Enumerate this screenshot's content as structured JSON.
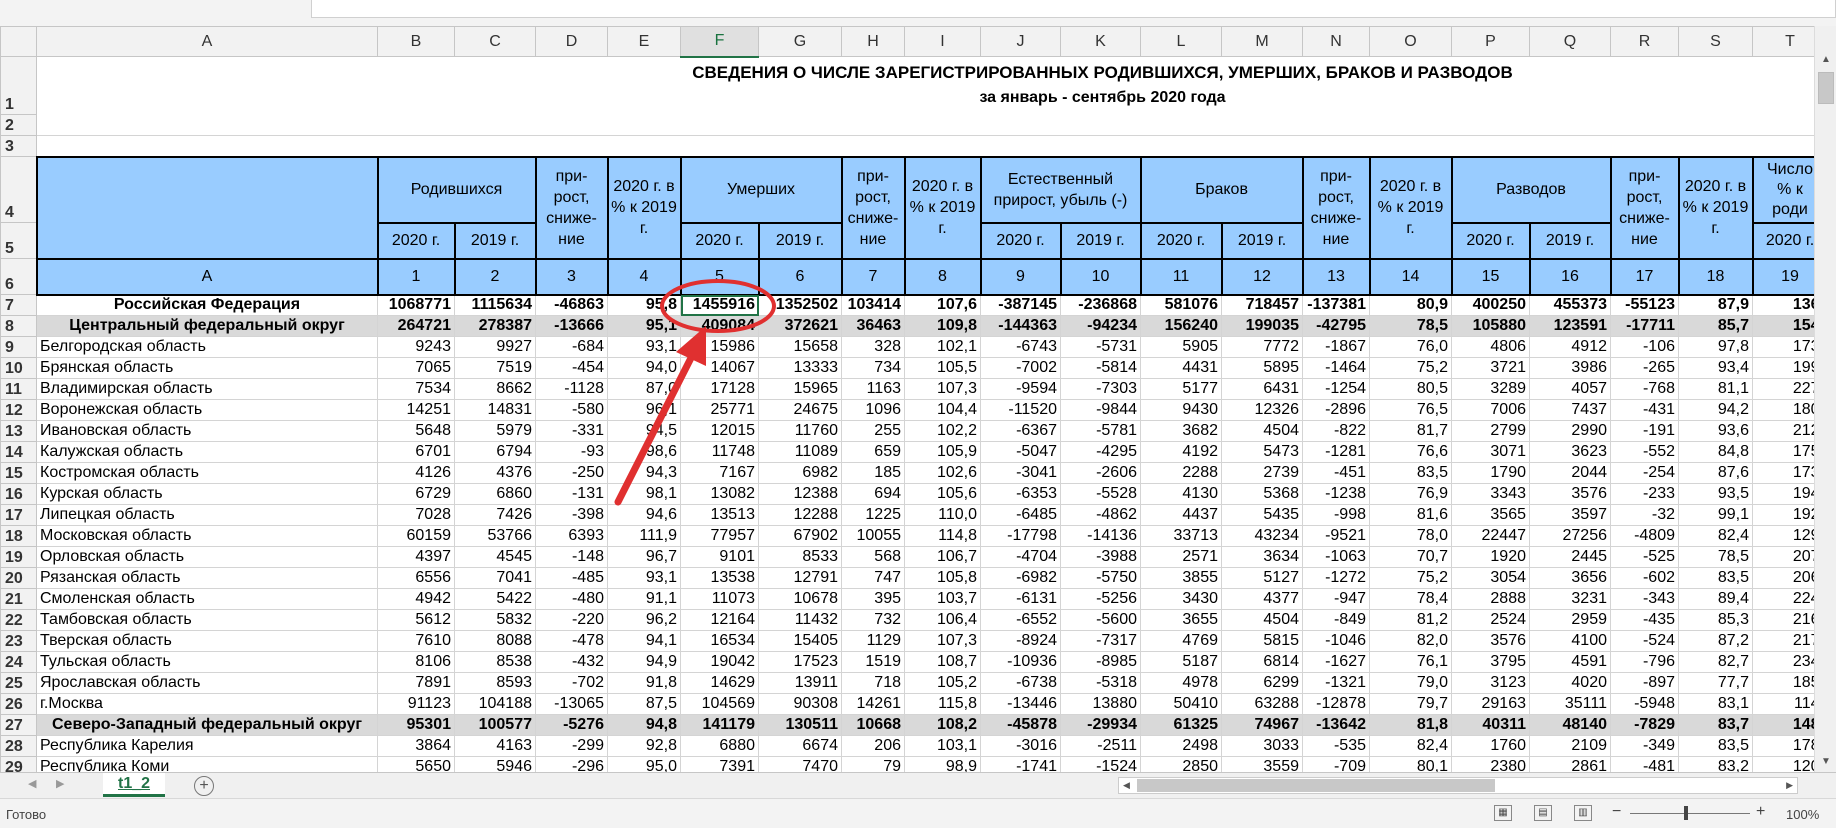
{
  "formula_bar": {
    "value": ""
  },
  "columns": [
    "A",
    "B",
    "C",
    "D",
    "E",
    "F",
    "G",
    "H",
    "I",
    "J",
    "K",
    "L",
    "M",
    "N",
    "O",
    "P",
    "Q",
    "R",
    "S",
    "T"
  ],
  "selected_column": "F",
  "title": {
    "line1": "СВЕДЕНИЯ О ЧИСЛЕ ЗАРЕГИСТРИРОВАННЫХ  РОДИВШИХСЯ, УМЕРШИХ, БРАКОВ И РАЗВОДОВ",
    "line2": "за январь - сентябрь 2020 года"
  },
  "header": {
    "births": "Родившихся",
    "deaths": "Умерших",
    "natural": "Естественный прирост, убыль (-)",
    "marriages": "Браков",
    "divorces": "Разводов",
    "growth": "при-рост, сниже-ние",
    "pct": "2020 г. в % к 2019 г.",
    "pct14": "2020 г. в % к 2019 г.",
    "pct_short": "2020 г. в % к 2019 г.",
    "t_num": "Число",
    "t_pct": "% к",
    "t_rod": "роди",
    "y2020": "2020 г.",
    "y2019": "2019 г.",
    "nums": [
      "A",
      "1",
      "2",
      "3",
      "4",
      "5",
      "6",
      "7",
      "8",
      "9",
      "10",
      "11",
      "12",
      "13",
      "14",
      "15",
      "16",
      "17",
      "18",
      "19"
    ]
  },
  "rows": [
    {
      "n": "7",
      "name": "Российская Федерация",
      "v": [
        "1068771",
        "1115634",
        "-46863",
        "95,8",
        "1455916",
        "1352502",
        "103414",
        "107,6",
        "-387145",
        "-236868",
        "581076",
        "718457",
        "-137381",
        "80,9",
        "400250",
        "455373",
        "-55123",
        "87,9",
        "136,"
      ]
    },
    {
      "n": "8",
      "name": "Центральный федеральный округ",
      "v": [
        "264721",
        "278387",
        "-13666",
        "95,1",
        "409084",
        "372621",
        "36463",
        "109,8",
        "-144363",
        "-94234",
        "156240",
        "199035",
        "-42795",
        "78,5",
        "105880",
        "123591",
        "-17711",
        "85,7",
        "154,"
      ]
    },
    {
      "n": "9",
      "name": "Белгородская область",
      "v": [
        "9243",
        "9927",
        "-684",
        "93,1",
        "15986",
        "15658",
        "328",
        "102,1",
        "-6743",
        "-5731",
        "5905",
        "7772",
        "-1867",
        "76,0",
        "4806",
        "4912",
        "-106",
        "97,8",
        "173,"
      ]
    },
    {
      "n": "10",
      "name": "Брянская область",
      "v": [
        "7065",
        "7519",
        "-454",
        "94,0",
        "14067",
        "13333",
        "734",
        "105,5",
        "-7002",
        "-5814",
        "4431",
        "5895",
        "-1464",
        "75,2",
        "3721",
        "3986",
        "-265",
        "93,4",
        "199,"
      ]
    },
    {
      "n": "11",
      "name": "Владимирская область",
      "v": [
        "7534",
        "8662",
        "-1128",
        "87,0",
        "17128",
        "15965",
        "1163",
        "107,3",
        "-9594",
        "-7303",
        "5177",
        "6431",
        "-1254",
        "80,5",
        "3289",
        "4057",
        "-768",
        "81,1",
        "227,"
      ]
    },
    {
      "n": "12",
      "name": "Воронежская область",
      "v": [
        "14251",
        "14831",
        "-580",
        "96,1",
        "25771",
        "24675",
        "1096",
        "104,4",
        "-11520",
        "-9844",
        "9430",
        "12326",
        "-2896",
        "76,5",
        "7006",
        "7437",
        "-431",
        "94,2",
        "180,"
      ]
    },
    {
      "n": "13",
      "name": "Ивановская область",
      "v": [
        "5648",
        "5979",
        "-331",
        "94,5",
        "12015",
        "11760",
        "255",
        "102,2",
        "-6367",
        "-5781",
        "3682",
        "4504",
        "-822",
        "81,7",
        "2799",
        "2990",
        "-191",
        "93,6",
        "212,"
      ]
    },
    {
      "n": "14",
      "name": "Калужская область",
      "v": [
        "6701",
        "6794",
        "-93",
        "98,6",
        "11748",
        "11089",
        "659",
        "105,9",
        "-5047",
        "-4295",
        "4192",
        "5473",
        "-1281",
        "76,6",
        "3071",
        "3623",
        "-552",
        "84,8",
        "175,"
      ]
    },
    {
      "n": "15",
      "name": "Костромская область",
      "v": [
        "4126",
        "4376",
        "-250",
        "94,3",
        "7167",
        "6982",
        "185",
        "102,6",
        "-3041",
        "-2606",
        "2288",
        "2739",
        "-451",
        "83,5",
        "1790",
        "2044",
        "-254",
        "87,6",
        "173,"
      ]
    },
    {
      "n": "16",
      "name": "Курская область",
      "v": [
        "6729",
        "6860",
        "-131",
        "98,1",
        "13082",
        "12388",
        "694",
        "105,6",
        "-6353",
        "-5528",
        "4130",
        "5368",
        "-1238",
        "76,9",
        "3343",
        "3576",
        "-233",
        "93,5",
        "194,"
      ]
    },
    {
      "n": "17",
      "name": "Липецкая область",
      "v": [
        "7028",
        "7426",
        "-398",
        "94,6",
        "13513",
        "12288",
        "1225",
        "110,0",
        "-6485",
        "-4862",
        "4437",
        "5435",
        "-998",
        "81,6",
        "3565",
        "3597",
        "-32",
        "99,1",
        "192,"
      ]
    },
    {
      "n": "18",
      "name": "Московская область",
      "v": [
        "60159",
        "53766",
        "6393",
        "111,9",
        "77957",
        "67902",
        "10055",
        "114,8",
        "-17798",
        "-14136",
        "33713",
        "43234",
        "-9521",
        "78,0",
        "22447",
        "27256",
        "-4809",
        "82,4",
        "129,"
      ]
    },
    {
      "n": "19",
      "name": "Орловская область",
      "v": [
        "4397",
        "4545",
        "-148",
        "96,7",
        "9101",
        "8533",
        "568",
        "106,7",
        "-4704",
        "-3988",
        "2571",
        "3634",
        "-1063",
        "70,7",
        "1920",
        "2445",
        "-525",
        "78,5",
        "207,"
      ]
    },
    {
      "n": "20",
      "name": "Рязанская область",
      "v": [
        "6556",
        "7041",
        "-485",
        "93,1",
        "13538",
        "12791",
        "747",
        "105,8",
        "-6982",
        "-5750",
        "3855",
        "5127",
        "-1272",
        "75,2",
        "3054",
        "3656",
        "-602",
        "83,5",
        "206,"
      ]
    },
    {
      "n": "21",
      "name": "Смоленская область",
      "v": [
        "4942",
        "5422",
        "-480",
        "91,1",
        "11073",
        "10678",
        "395",
        "103,7",
        "-6131",
        "-5256",
        "3430",
        "4377",
        "-947",
        "78,4",
        "2888",
        "3231",
        "-343",
        "89,4",
        "224,"
      ]
    },
    {
      "n": "22",
      "name": "Тамбовская область",
      "v": [
        "5612",
        "5832",
        "-220",
        "96,2",
        "12164",
        "11432",
        "732",
        "106,4",
        "-6552",
        "-5600",
        "3655",
        "4504",
        "-849",
        "81,2",
        "2524",
        "2959",
        "-435",
        "85,3",
        "216,"
      ]
    },
    {
      "n": "23",
      "name": "Тверская область",
      "v": [
        "7610",
        "8088",
        "-478",
        "94,1",
        "16534",
        "15405",
        "1129",
        "107,3",
        "-8924",
        "-7317",
        "4769",
        "5815",
        "-1046",
        "82,0",
        "3576",
        "4100",
        "-524",
        "87,2",
        "217,"
      ]
    },
    {
      "n": "24",
      "name": "Тульская область",
      "v": [
        "8106",
        "8538",
        "-432",
        "94,9",
        "19042",
        "17523",
        "1519",
        "108,7",
        "-10936",
        "-8985",
        "5187",
        "6814",
        "-1627",
        "76,1",
        "3795",
        "4591",
        "-796",
        "82,7",
        "234,"
      ]
    },
    {
      "n": "25",
      "name": "Ярославская область",
      "v": [
        "7891",
        "8593",
        "-702",
        "91,8",
        "14629",
        "13911",
        "718",
        "105,2",
        "-6738",
        "-5318",
        "4978",
        "6299",
        "-1321",
        "79,0",
        "3123",
        "4020",
        "-897",
        "77,7",
        "185,"
      ]
    },
    {
      "n": "26",
      "name": "г.Москва",
      "v": [
        "91123",
        "104188",
        "-13065",
        "87,5",
        "104569",
        "90308",
        "14261",
        "115,8",
        "-13446",
        "13880",
        "50410",
        "63288",
        "-12878",
        "79,7",
        "29163",
        "35111",
        "-5948",
        "83,1",
        "114,"
      ]
    },
    {
      "n": "27",
      "name": "Северо-Западный федеральный округ",
      "v": [
        "95301",
        "100577",
        "-5276",
        "94,8",
        "141179",
        "130511",
        "10668",
        "108,2",
        "-45878",
        "-29934",
        "61325",
        "74967",
        "-13642",
        "81,8",
        "40311",
        "48140",
        "-7829",
        "83,7",
        "148,"
      ]
    },
    {
      "n": "28",
      "name": "Республика Карелия",
      "v": [
        "3864",
        "4163",
        "-299",
        "92,8",
        "6880",
        "6674",
        "206",
        "103,1",
        "-3016",
        "-2511",
        "2498",
        "3033",
        "-535",
        "82,4",
        "1760",
        "2109",
        "-349",
        "83,5",
        "178,"
      ]
    },
    {
      "n": "29",
      "name": "Республика Коми",
      "v": [
        "5650",
        "5946",
        "-296",
        "95,0",
        "7391",
        "7470",
        "79",
        "98,9",
        "-1741",
        "-1524",
        "2850",
        "3559",
        "-709",
        "80,1",
        "2380",
        "2861",
        "-481",
        "83,2",
        "120,"
      ]
    }
  ],
  "bold_rows": [
    "7",
    "8",
    "27"
  ],
  "sheet_tab": "t1_2",
  "status": {
    "ready": "Готово",
    "zoom": "100%"
  },
  "annotation_color": "#e03030"
}
